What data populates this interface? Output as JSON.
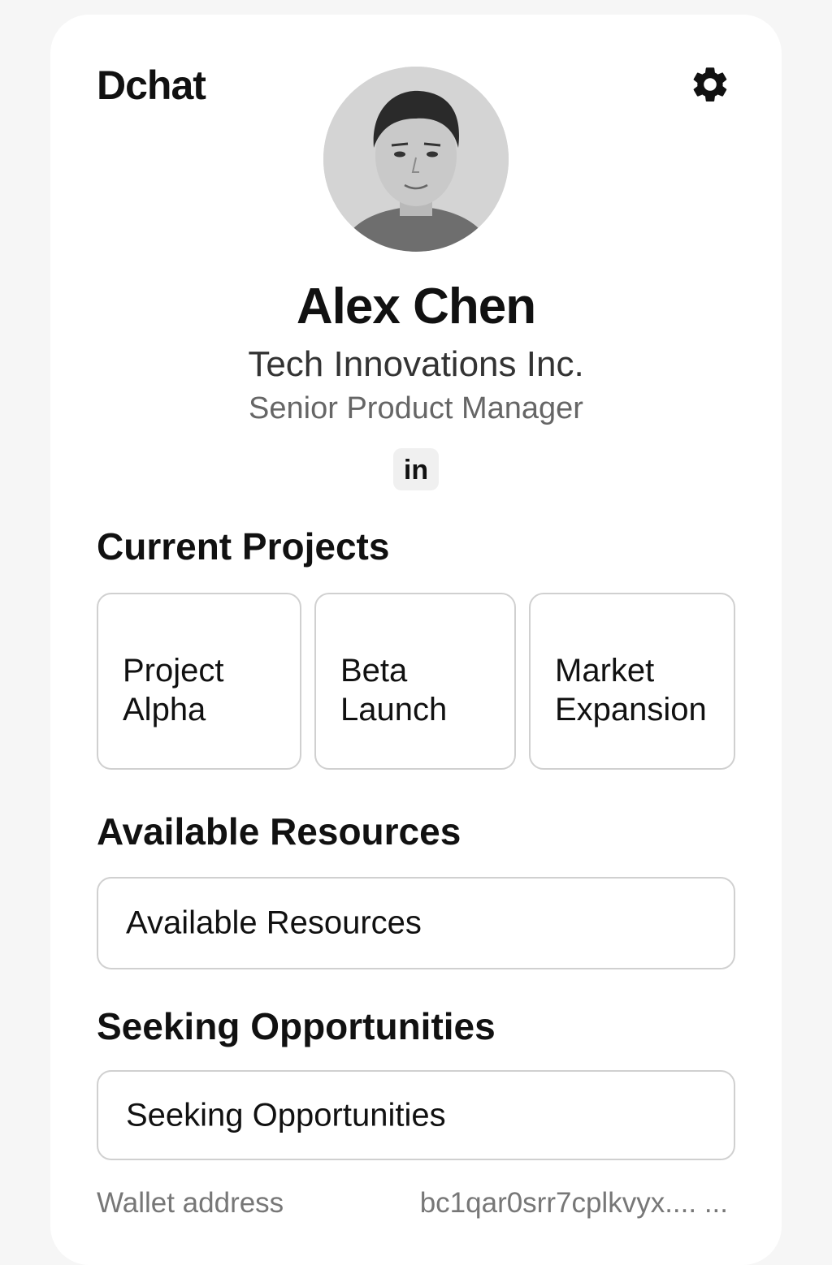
{
  "app": {
    "name": "Dchat",
    "settings_icon": "gear-icon"
  },
  "profile": {
    "avatar_icon": "avatar-photo",
    "name": "Alex Chen",
    "company": "Tech Innovations Inc.",
    "title": "Senior Product Manager",
    "linkedin_label": "in"
  },
  "projects": {
    "heading": "Current Projects",
    "items": [
      {
        "line1": "Project",
        "line2": "Alpha"
      },
      {
        "line1": "Beta",
        "line2": "Launch"
      },
      {
        "line1": "Market",
        "line2": "Expansion"
      }
    ]
  },
  "resources": {
    "heading": "Available Resources",
    "field_value": "Available Resources"
  },
  "opportunities": {
    "heading": "Seeking Opportunities",
    "field_value": "Seeking Opportunities"
  },
  "wallet": {
    "label": "Wallet address",
    "value": "bc1qar0srr7cplkvyx.... ..."
  },
  "colors": {
    "background": "#f6f6f6",
    "card": "#ffffff",
    "text": "#111111",
    "muted": "#777777",
    "border": "#d0d0d0"
  }
}
